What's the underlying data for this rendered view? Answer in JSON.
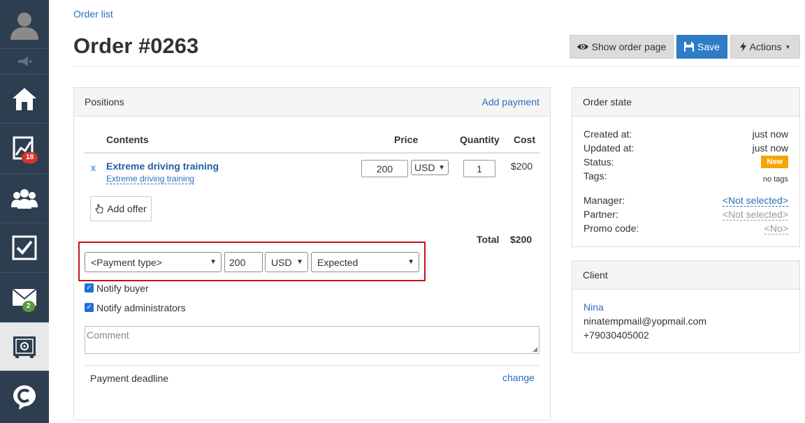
{
  "sidebar": {
    "badges": {
      "stats": "18",
      "mail": "2"
    }
  },
  "breadcrumb": "Order list",
  "page_title": "Order #0263",
  "toolbar": {
    "show_order_page": "Show order page",
    "save": "Save",
    "actions": "Actions"
  },
  "positions": {
    "title": "Positions",
    "add_payment": "Add payment",
    "columns": {
      "contents": "Contents",
      "price": "Price",
      "quantity": "Quantity",
      "cost": "Cost"
    },
    "item": {
      "remove": "x",
      "name": "Extreme driving training",
      "offer": "Extreme driving training",
      "price": "200",
      "currency": "USD",
      "quantity": "1",
      "cost": "$200"
    },
    "add_offer": "Add offer",
    "total_label": "Total",
    "total_value": "$200"
  },
  "payment": {
    "type": "<Payment type>",
    "amount": "200",
    "currency": "USD",
    "status": "Expected"
  },
  "notify": {
    "buyer": "Notify buyer",
    "admins": "Notify administrators"
  },
  "comment_placeholder": "Comment",
  "deadline": {
    "label": "Payment deadline",
    "change": "change"
  },
  "order_state": {
    "title": "Order state",
    "created_label": "Created at:",
    "created_value": "just now",
    "updated_label": "Updated at:",
    "updated_value": "just now",
    "status_label": "Status:",
    "status_value": "New",
    "tags_label": "Tags:",
    "tags_value": "no tags",
    "manager_label": "Manager:",
    "manager_value": "<Not selected>",
    "partner_label": "Partner:",
    "partner_value": "<Not selected>",
    "promo_label": "Promo code:",
    "promo_value": "<No>"
  },
  "client": {
    "title": "Client",
    "name": "Nina",
    "email": "ninatempmail@yopmail.com",
    "phone": "+79030405002"
  },
  "colors": {
    "sidebar": "#2c3e50",
    "link": "#2a6ebb",
    "save_button": "#2e7cc5",
    "status_new": "#f5a50a",
    "highlight": "#c0141b"
  }
}
